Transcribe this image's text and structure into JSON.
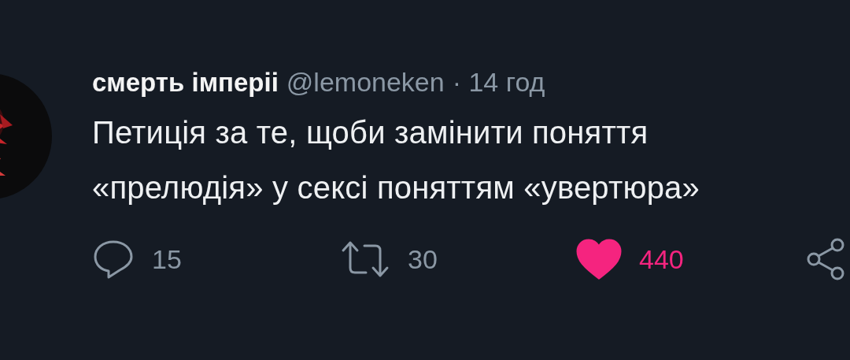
{
  "tweet": {
    "author": {
      "name": "смерть імперіі",
      "handle": "@lemoneken",
      "time": "· 14 год"
    },
    "text_lines": [
      "Петиція за те, щоби замінити поняття",
      "«прелюдія» у сексі поняттям «увертюра»"
    ],
    "actions": [
      {
        "kind": "reply",
        "count": "15"
      },
      {
        "kind": "retweet",
        "count": "30"
      },
      {
        "kind": "like",
        "count": "440",
        "liked": true
      },
      {
        "kind": "share"
      }
    ]
  }
}
